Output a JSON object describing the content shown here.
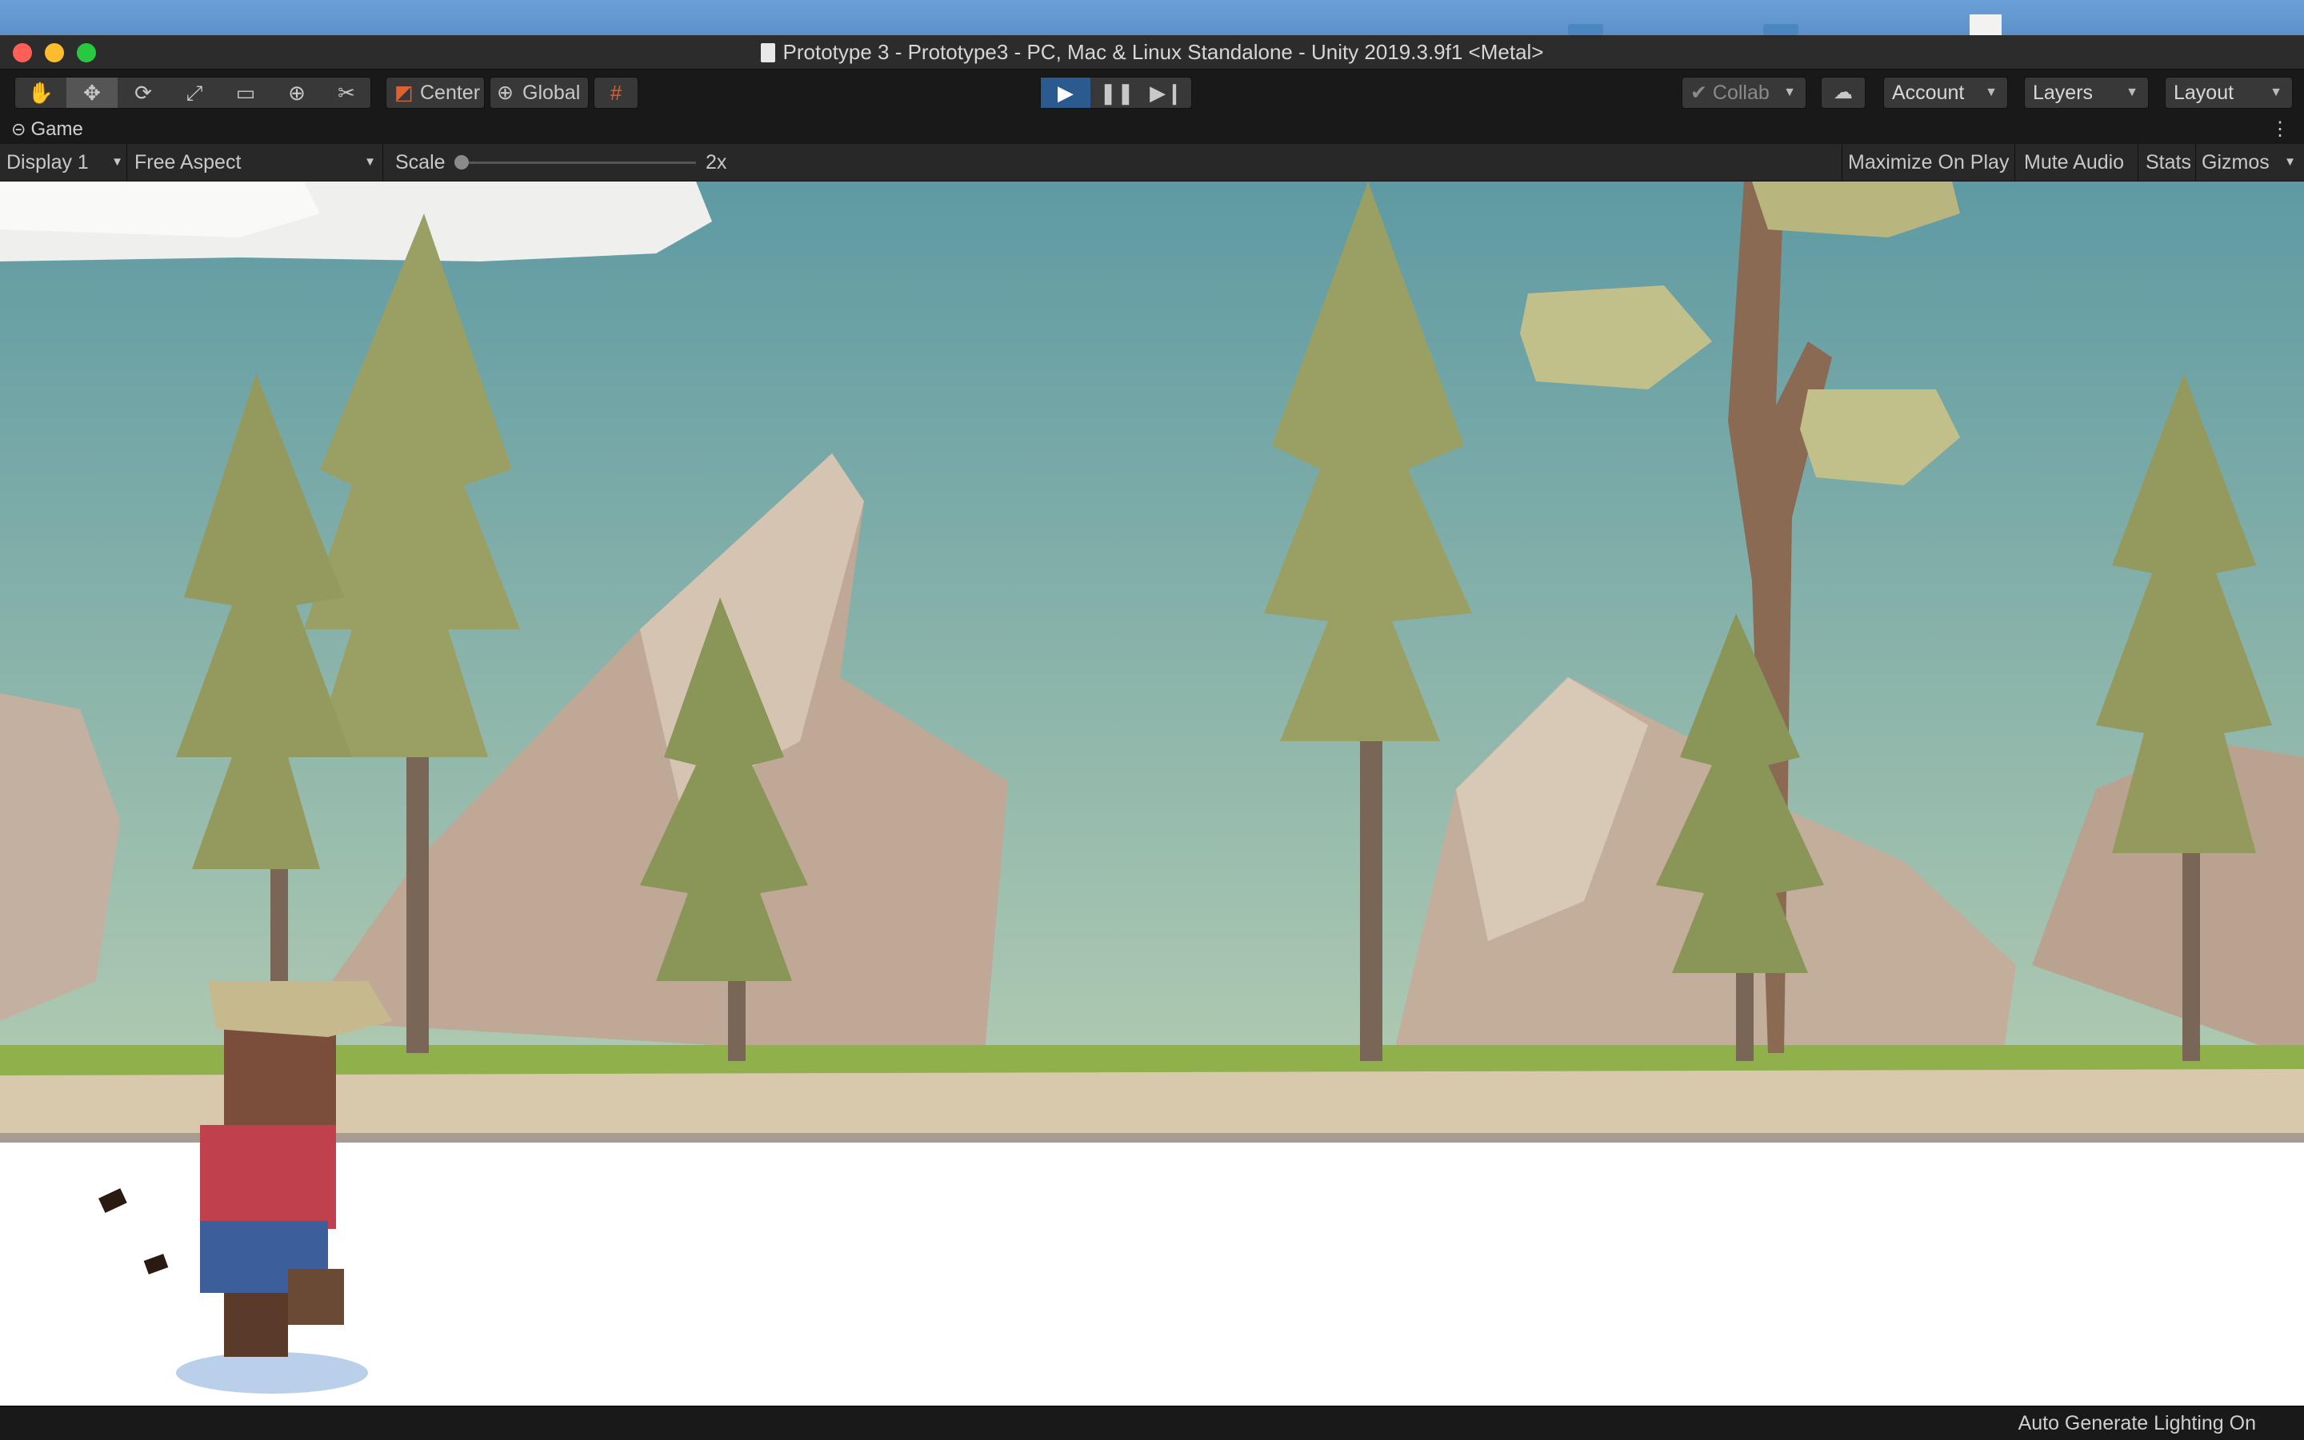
{
  "window": {
    "title": "Prototype 3 - Prototype3 - PC, Mac & Linux Standalone - Unity 2019.3.9f1 <Metal>"
  },
  "toolbar": {
    "tools": [
      "hand-tool-icon",
      "move-tool-icon",
      "rotate-tool-icon",
      "scale-tool-icon",
      "rect-tool-icon",
      "transform-tool-icon",
      "custom-tool-icon"
    ],
    "pivot_label": "Center",
    "space_label": "Global",
    "collab_label": "Collab",
    "account_label": "Account",
    "layers_label": "Layers",
    "layout_label": "Layout"
  },
  "game_tab": {
    "label": "Game",
    "display_label": "Display 1",
    "aspect_label": "Free Aspect",
    "scale_label": "Scale",
    "scale_value": "2x",
    "maximize_label": "Maximize On Play",
    "mute_label": "Mute Audio",
    "stats_label": "Stats",
    "gizmos_label": "Gizmos"
  },
  "status": {
    "lighting_text": "Auto Generate Lighting On"
  },
  "colors": {
    "play_active": "#2a5a8e",
    "sky_top": "#5e9aa3",
    "sky_bottom": "#a9c4ae",
    "grass": "#8fb04a",
    "rock": "#c8b4a0",
    "tree": "#9aa064"
  }
}
